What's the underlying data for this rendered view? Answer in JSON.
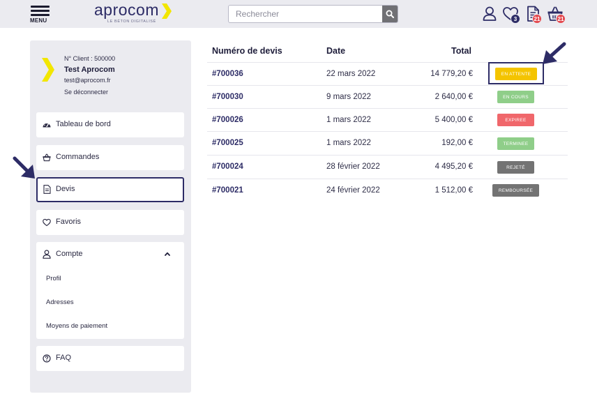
{
  "header": {
    "menu_label": "MENU",
    "logo_text": "aprocom",
    "logo_tagline": "LE BÉTON DIGITALISÉ",
    "search_placeholder": "Rechercher",
    "favorites_count": "3",
    "quotes_count": "21",
    "cart_count": "21",
    "badge_colors": {
      "favorites": "#2d2c66",
      "quotes": "#e4484e",
      "cart": "#e4484e"
    }
  },
  "sidebar": {
    "client_number": "N° Client : 500000",
    "user_name": "Test Aprocom",
    "user_email": "test@aprocom.fr",
    "logout_label": "Se déconnecter",
    "nav": {
      "dashboard": "Tableau de bord",
      "orders": "Commandes",
      "quotes": "Devis",
      "favorites": "Favoris",
      "account": "Compte",
      "faq": "FAQ"
    },
    "account_sub": {
      "profile": "Profil",
      "addresses": "Adresses",
      "payment": "Moyens de paiement"
    }
  },
  "table": {
    "headers": {
      "number": "Numéro de devis",
      "date": "Date",
      "total": "Total"
    },
    "rows": [
      {
        "number": "#700036",
        "date": "22 mars 2022",
        "total": "14 779,20 €",
        "status": "EN ATTENTE",
        "status_color": "#f4c400"
      },
      {
        "number": "#700030",
        "date": "9 mars 2022",
        "total": "2 640,00 €",
        "status": "EN COURS",
        "status_color": "#8fce89"
      },
      {
        "number": "#700026",
        "date": "1 mars 2022",
        "total": "5 400,00 €",
        "status": "EXPIREE",
        "status_color": "#f0676b"
      },
      {
        "number": "#700025",
        "date": "1 mars 2022",
        "total": "192,00 €",
        "status": "TERMINEE",
        "status_color": "#8fce89"
      },
      {
        "number": "#700024",
        "date": "28 février 2022",
        "total": "4 495,20 €",
        "status": "REJETÉ",
        "status_color": "#737373"
      },
      {
        "number": "#700021",
        "date": "24 février 2022",
        "total": "1 512,00 €",
        "status": "REMBOURSÉE",
        "status_color": "#737373"
      }
    ]
  },
  "colors": {
    "brand_navy": "#2d2c66",
    "brand_yellow": "#f2e600",
    "panel_bg": "#ebebf0"
  }
}
